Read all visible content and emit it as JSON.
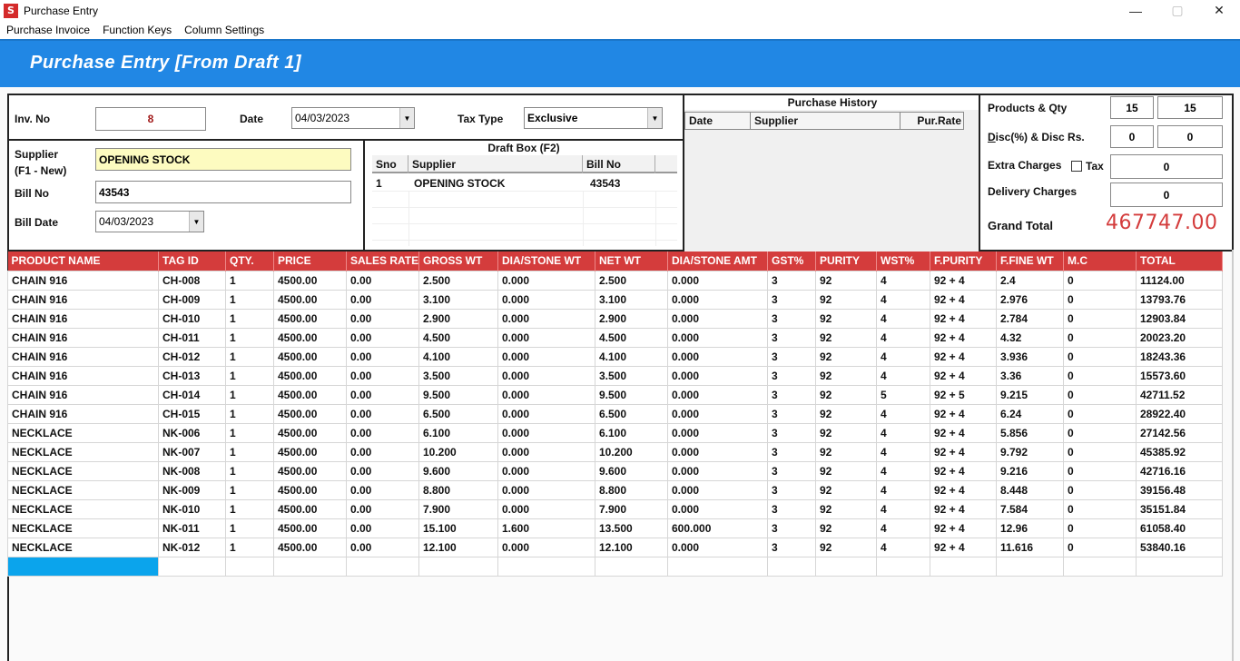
{
  "window": {
    "title": "Purchase Entry",
    "app_icon": "S",
    "controls": {
      "minimize": "—",
      "restore": "▢",
      "close": "✕"
    }
  },
  "menu": [
    "Purchase Invoice",
    "Function Keys",
    "Column Settings"
  ],
  "banner": {
    "title": "Purchase Entry [From Draft 1]",
    "color": "#2187e4"
  },
  "invoice": {
    "inv_no_label": "Inv. No",
    "inv_no": "8",
    "date_label": "Date",
    "date": "04/03/2023",
    "tax_type_label": "Tax Type",
    "tax_type": "Exclusive",
    "supplier_label": "Supplier",
    "supplier_sub_label": "(F1 - New)",
    "supplier": "OPENING STOCK",
    "bill_no_label": "Bill No",
    "bill_no": "43543",
    "bill_date_label": "Bill Date",
    "bill_date": "04/03/2023"
  },
  "draft_box": {
    "title": "Draft Box (F2)",
    "columns": [
      "Sno",
      "Supplier",
      "Bill No"
    ],
    "rows": [
      {
        "sno": "1",
        "supplier": "OPENING STOCK",
        "bill_no": "43543"
      }
    ]
  },
  "purchase_history": {
    "title": "Purchase History",
    "columns": [
      "Date",
      "Supplier",
      "Pur.Rate"
    ],
    "rows": []
  },
  "summary": {
    "products_qty_label": "Products & Qty",
    "products": "15",
    "qty": "15",
    "disc_label": "Disc(%) & Disc Rs.",
    "disc_pct": "0",
    "disc_rs": "0",
    "extra_charges_label": "Extra Charges",
    "tax_checkbox_label": "Tax",
    "tax_checked": false,
    "extra_charges": "0",
    "delivery_charges_label": "Delivery Charges",
    "delivery_charges": "0",
    "grand_total_label": "Grand Total",
    "grand_total": "467747.00"
  },
  "grid": {
    "header_color": "#d43c3c",
    "columns": [
      "PRODUCT NAME",
      "TAG ID",
      "QTY.",
      "PRICE",
      "SALES RATE",
      "GROSS WT",
      "DIA/STONE WT",
      "NET WT",
      "DIA/STONE AMT",
      "GST%",
      "PURITY",
      "WST%",
      "F.PURITY",
      "F.FINE WT",
      "M.C",
      "TOTAL"
    ],
    "rows": [
      [
        "CHAIN 916",
        "CH-008",
        "1",
        "4500.00",
        "0.00",
        "2.500",
        "0.000",
        "2.500",
        "0.000",
        "3",
        "92",
        "4",
        "92 + 4",
        "2.4",
        "0",
        "11124.00"
      ],
      [
        "CHAIN 916",
        "CH-009",
        "1",
        "4500.00",
        "0.00",
        "3.100",
        "0.000",
        "3.100",
        "0.000",
        "3",
        "92",
        "4",
        "92 + 4",
        "2.976",
        "0",
        "13793.76"
      ],
      [
        "CHAIN 916",
        "CH-010",
        "1",
        "4500.00",
        "0.00",
        "2.900",
        "0.000",
        "2.900",
        "0.000",
        "3",
        "92",
        "4",
        "92 + 4",
        "2.784",
        "0",
        "12903.84"
      ],
      [
        "CHAIN 916",
        "CH-011",
        "1",
        "4500.00",
        "0.00",
        "4.500",
        "0.000",
        "4.500",
        "0.000",
        "3",
        "92",
        "4",
        "92 + 4",
        "4.32",
        "0",
        "20023.20"
      ],
      [
        "CHAIN 916",
        "CH-012",
        "1",
        "4500.00",
        "0.00",
        "4.100",
        "0.000",
        "4.100",
        "0.000",
        "3",
        "92",
        "4",
        "92 + 4",
        "3.936",
        "0",
        "18243.36"
      ],
      [
        "CHAIN 916",
        "CH-013",
        "1",
        "4500.00",
        "0.00",
        "3.500",
        "0.000",
        "3.500",
        "0.000",
        "3",
        "92",
        "4",
        "92 + 4",
        "3.36",
        "0",
        "15573.60"
      ],
      [
        "CHAIN 916",
        "CH-014",
        "1",
        "4500.00",
        "0.00",
        "9.500",
        "0.000",
        "9.500",
        "0.000",
        "3",
        "92",
        "5",
        "92 + 5",
        "9.215",
        "0",
        "42711.52"
      ],
      [
        "CHAIN 916",
        "CH-015",
        "1",
        "4500.00",
        "0.00",
        "6.500",
        "0.000",
        "6.500",
        "0.000",
        "3",
        "92",
        "4",
        "92 + 4",
        "6.24",
        "0",
        "28922.40"
      ],
      [
        "NECKLACE",
        "NK-006",
        "1",
        "4500.00",
        "0.00",
        "6.100",
        "0.000",
        "6.100",
        "0.000",
        "3",
        "92",
        "4",
        "92 + 4",
        "5.856",
        "0",
        "27142.56"
      ],
      [
        "NECKLACE",
        "NK-007",
        "1",
        "4500.00",
        "0.00",
        "10.200",
        "0.000",
        "10.200",
        "0.000",
        "3",
        "92",
        "4",
        "92 + 4",
        "9.792",
        "0",
        "45385.92"
      ],
      [
        "NECKLACE",
        "NK-008",
        "1",
        "4500.00",
        "0.00",
        "9.600",
        "0.000",
        "9.600",
        "0.000",
        "3",
        "92",
        "4",
        "92 + 4",
        "9.216",
        "0",
        "42716.16"
      ],
      [
        "NECKLACE",
        "NK-009",
        "1",
        "4500.00",
        "0.00",
        "8.800",
        "0.000",
        "8.800",
        "0.000",
        "3",
        "92",
        "4",
        "92 + 4",
        "8.448",
        "0",
        "39156.48"
      ],
      [
        "NECKLACE",
        "NK-010",
        "1",
        "4500.00",
        "0.00",
        "7.900",
        "0.000",
        "7.900",
        "0.000",
        "3",
        "92",
        "4",
        "92 + 4",
        "7.584",
        "0",
        "35151.84"
      ],
      [
        "NECKLACE",
        "NK-011",
        "1",
        "4500.00",
        "0.00",
        "15.100",
        "1.600",
        "13.500",
        "600.000",
        "3",
        "92",
        "4",
        "92 + 4",
        "12.96",
        "0",
        "61058.40"
      ],
      [
        "NECKLACE",
        "NK-012",
        "1",
        "4500.00",
        "0.00",
        "12.100",
        "0.000",
        "12.100",
        "0.000",
        "3",
        "92",
        "4",
        "92 + 4",
        "11.616",
        "0",
        "53840.16"
      ]
    ]
  }
}
